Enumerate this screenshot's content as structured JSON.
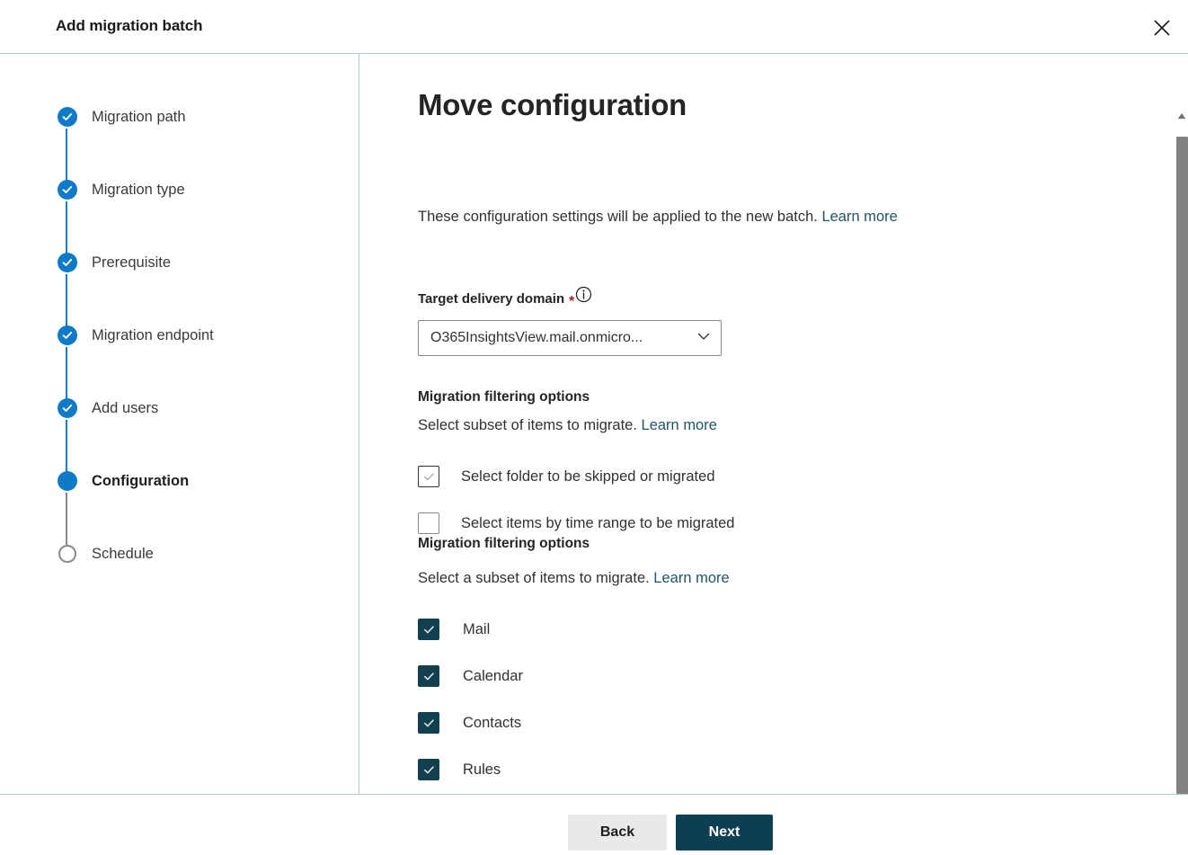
{
  "window": {
    "title": "Add migration batch",
    "close_icon": "close-icon"
  },
  "stepper": {
    "steps": [
      {
        "label": "Migration path",
        "state": "done"
      },
      {
        "label": "Migration type",
        "state": "done"
      },
      {
        "label": "Prerequisite",
        "state": "done"
      },
      {
        "label": "Migration endpoint",
        "state": "done"
      },
      {
        "label": "Add users",
        "state": "done"
      },
      {
        "label": "Configuration",
        "state": "current"
      },
      {
        "label": "Schedule",
        "state": "todo"
      }
    ],
    "colors": {
      "done": "#0f7ac8",
      "current": "#0f7ac8",
      "todo_border": "#8a8886"
    }
  },
  "main": {
    "page_title": "Move configuration",
    "intro_text": "These configuration settings will be applied to the new batch. ",
    "intro_link": "Learn more",
    "target_domain": {
      "label": "Target delivery domain",
      "required_marker": "*",
      "info_icon": "info-circle-icon",
      "value": "O365InsightsView.mail.onmicro...",
      "chevron_icon": "chevron-down-icon"
    },
    "section_one": {
      "heading": "Migration filtering options",
      "subtitle": "Select subset of items to migrate. ",
      "subtitle_link": "Learn more",
      "options": [
        {
          "label": "Select folder to be skipped or migrated",
          "state": "hovered"
        },
        {
          "label": "Select items by time range to be migrated",
          "state": "unchecked"
        }
      ]
    },
    "section_two": {
      "heading": "Migration filtering options",
      "subtitle": "Select a subset of items to migrate. ",
      "subtitle_link": "Learn more",
      "options": [
        {
          "label": "Mail",
          "state": "checked"
        },
        {
          "label": "Calendar",
          "state": "checked"
        },
        {
          "label": "Contacts",
          "state": "checked"
        },
        {
          "label": "Rules",
          "state": "checked"
        }
      ]
    }
  },
  "footer": {
    "back_label": "Back",
    "next_label": "Next",
    "next_color": "#0d3e51",
    "back_color": "#e9e9e9"
  },
  "scrollbar": {
    "up_icon": "scroll-up-arrow-icon",
    "down_icon": "scroll-down-arrow-icon"
  }
}
